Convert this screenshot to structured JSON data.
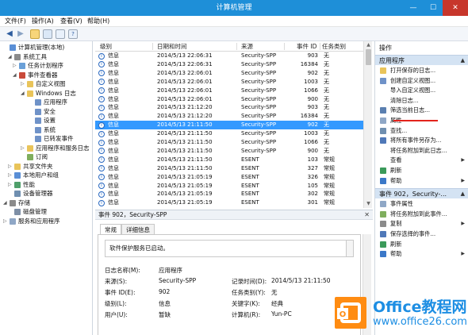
{
  "window": {
    "title": "计算机管理",
    "minimize": "—",
    "maximize": "☐",
    "close": "✕"
  },
  "menu": [
    "文件(F)",
    "操作(A)",
    "查看(V)",
    "帮助(H)"
  ],
  "tree": [
    {
      "label": "计算机管理(本地)",
      "icon": "computer-icon",
      "expand": ""
    },
    {
      "label": "系统工具",
      "icon": "tools-icon",
      "expand": "◢"
    },
    {
      "label": "任务计划程序",
      "icon": "clock-icon",
      "expand": "▷"
    },
    {
      "label": "事件查看器",
      "icon": "event-viewer-icon",
      "expand": "◢"
    },
    {
      "label": "自定义视图",
      "icon": "folder-icon",
      "expand": "▷"
    },
    {
      "label": "Windows 日志",
      "icon": "folder-icon",
      "expand": "◢"
    },
    {
      "label": "应用程序",
      "icon": "log-icon",
      "expand": ""
    },
    {
      "label": "安全",
      "icon": "log-icon",
      "expand": ""
    },
    {
      "label": "设置",
      "icon": "log-icon",
      "expand": ""
    },
    {
      "label": "系统",
      "icon": "log-icon",
      "expand": ""
    },
    {
      "label": "已转发事件",
      "icon": "log-icon",
      "expand": ""
    },
    {
      "label": "应用程序和服务日志",
      "icon": "folder-icon",
      "expand": "▷"
    },
    {
      "label": "订阅",
      "icon": "subscription-icon",
      "expand": ""
    },
    {
      "label": "共享文件夹",
      "icon": "folder-icon",
      "expand": "▷"
    },
    {
      "label": "本地用户和组",
      "icon": "users-icon",
      "expand": "▷"
    },
    {
      "label": "性能",
      "icon": "performance-icon",
      "expand": "▷"
    },
    {
      "label": "设备管理器",
      "icon": "device-icon",
      "expand": ""
    },
    {
      "label": "存储",
      "icon": "storage-icon",
      "expand": "◢"
    },
    {
      "label": "磁盘管理",
      "icon": "disk-icon",
      "expand": ""
    },
    {
      "label": "服务和应用程序",
      "icon": "services-icon",
      "expand": "▷"
    }
  ],
  "events": {
    "columns": [
      "级别",
      "日期和时间",
      "来源",
      "事件 ID",
      "任务类别"
    ],
    "rows": [
      {
        "level": "信息",
        "datetime": "2014/5/13 22:06:31",
        "source": "Security-SPP",
        "id": "903",
        "task": "无"
      },
      {
        "level": "信息",
        "datetime": "2014/5/13 22:06:31",
        "source": "Security-SPP",
        "id": "16384",
        "task": "无"
      },
      {
        "level": "信息",
        "datetime": "2014/5/13 22:06:01",
        "source": "Security-SPP",
        "id": "902",
        "task": "无"
      },
      {
        "level": "信息",
        "datetime": "2014/5/13 22:06:01",
        "source": "Security-SPP",
        "id": "1003",
        "task": "无"
      },
      {
        "level": "信息",
        "datetime": "2014/5/13 22:06:01",
        "source": "Security-SPP",
        "id": "1066",
        "task": "无"
      },
      {
        "level": "信息",
        "datetime": "2014/5/13 22:06:01",
        "source": "Security-SPP",
        "id": "900",
        "task": "无"
      },
      {
        "level": "信息",
        "datetime": "2014/5/13 21:12:20",
        "source": "Security-SPP",
        "id": "903",
        "task": "无"
      },
      {
        "level": "信息",
        "datetime": "2014/5/13 21:12:20",
        "source": "Security-SPP",
        "id": "16384",
        "task": "无"
      },
      {
        "level": "信息",
        "datetime": "2014/5/13 21:11:50",
        "source": "Security-SPP",
        "id": "902",
        "task": "无"
      },
      {
        "level": "信息",
        "datetime": "2014/5/13 21:11:50",
        "source": "Security-SPP",
        "id": "1003",
        "task": "无"
      },
      {
        "level": "信息",
        "datetime": "2014/5/13 21:11:50",
        "source": "Security-SPP",
        "id": "1066",
        "task": "无"
      },
      {
        "level": "信息",
        "datetime": "2014/5/13 21:11:50",
        "source": "Security-SPP",
        "id": "900",
        "task": "无"
      },
      {
        "level": "信息",
        "datetime": "2014/5/13 21:11:50",
        "source": "ESENT",
        "id": "103",
        "task": "常规"
      },
      {
        "level": "信息",
        "datetime": "2014/5/13 21:11:50",
        "source": "ESENT",
        "id": "327",
        "task": "常规"
      },
      {
        "level": "信息",
        "datetime": "2014/5/13 21:05:19",
        "source": "ESENT",
        "id": "326",
        "task": "常规"
      },
      {
        "level": "信息",
        "datetime": "2014/5/13 21:05:19",
        "source": "ESENT",
        "id": "105",
        "task": "常规"
      },
      {
        "level": "信息",
        "datetime": "2014/5/13 21:05:19",
        "source": "ESENT",
        "id": "302",
        "task": "常规"
      },
      {
        "level": "信息",
        "datetime": "2014/5/13 21:05:19",
        "source": "ESENT",
        "id": "301",
        "task": "常规"
      }
    ],
    "selected_index": 8
  },
  "detail": {
    "title": "事件 902，Security-SPP",
    "close": "✕",
    "tabs": [
      "常规",
      "详细信息"
    ],
    "message": "软件保护服务已启动。",
    "left_fields": [
      {
        "label": "日志名称(M):",
        "value": "应用程序"
      },
      {
        "label": "来源(S):",
        "value": "Security-SPP"
      },
      {
        "label": "事件 ID(E):",
        "value": "902"
      },
      {
        "label": "级别(L):",
        "value": "信息"
      },
      {
        "label": "用户(U):",
        "value": "暂缺"
      }
    ],
    "right_fields": [
      {
        "label": "记录时间(D):",
        "value": "2014/5/13 21:11:50"
      },
      {
        "label": "任务类别(Y):",
        "value": "无"
      },
      {
        "label": "关键字(K):",
        "value": "经典"
      },
      {
        "label": "计算机(R):",
        "value": "Yun-PC"
      }
    ]
  },
  "actions": {
    "header": "操作",
    "section1": "应用程序",
    "items1": [
      {
        "label": "打开保存的日志...",
        "icon": "open-log-icon",
        "sub": ""
      },
      {
        "label": "创建自定义视图...",
        "icon": "filter-create-icon",
        "sub": ""
      },
      {
        "label": "导入自定义视图...",
        "icon": "",
        "sub": ""
      },
      {
        "label": "清除日志...",
        "icon": "",
        "sub": ""
      },
      {
        "label": "筛选当前日志...",
        "icon": "filter-icon",
        "sub": ""
      },
      {
        "label": "属性",
        "icon": "properties-icon",
        "sub": ""
      },
      {
        "label": "查找...",
        "icon": "find-icon",
        "sub": ""
      },
      {
        "label": "将所有事件另存为...",
        "icon": "save-icon",
        "sub": ""
      },
      {
        "label": "将任务附加到此日志...",
        "icon": "",
        "sub": ""
      },
      {
        "label": "查看",
        "icon": "",
        "sub": "▶"
      },
      {
        "label": "刷新",
        "icon": "refresh-icon",
        "sub": ""
      },
      {
        "label": "帮助",
        "icon": "help-icon",
        "sub": "▶"
      }
    ],
    "section2": "事件 902，Security-...",
    "items2": [
      {
        "label": "事件属性",
        "icon": "properties-icon",
        "sub": ""
      },
      {
        "label": "将任务附加到此事件...",
        "icon": "task-icon",
        "sub": ""
      },
      {
        "label": "复制",
        "icon": "copy-icon",
        "sub": "▶"
      },
      {
        "label": "保存选择的事件...",
        "icon": "save-icon",
        "sub": ""
      },
      {
        "label": "刷新",
        "icon": "refresh-icon",
        "sub": ""
      },
      {
        "label": "帮助",
        "icon": "help-icon",
        "sub": "▶"
      }
    ],
    "section_arrow": "▲"
  },
  "watermark": {
    "title": "Office教程网",
    "url": "www.office26.com"
  }
}
